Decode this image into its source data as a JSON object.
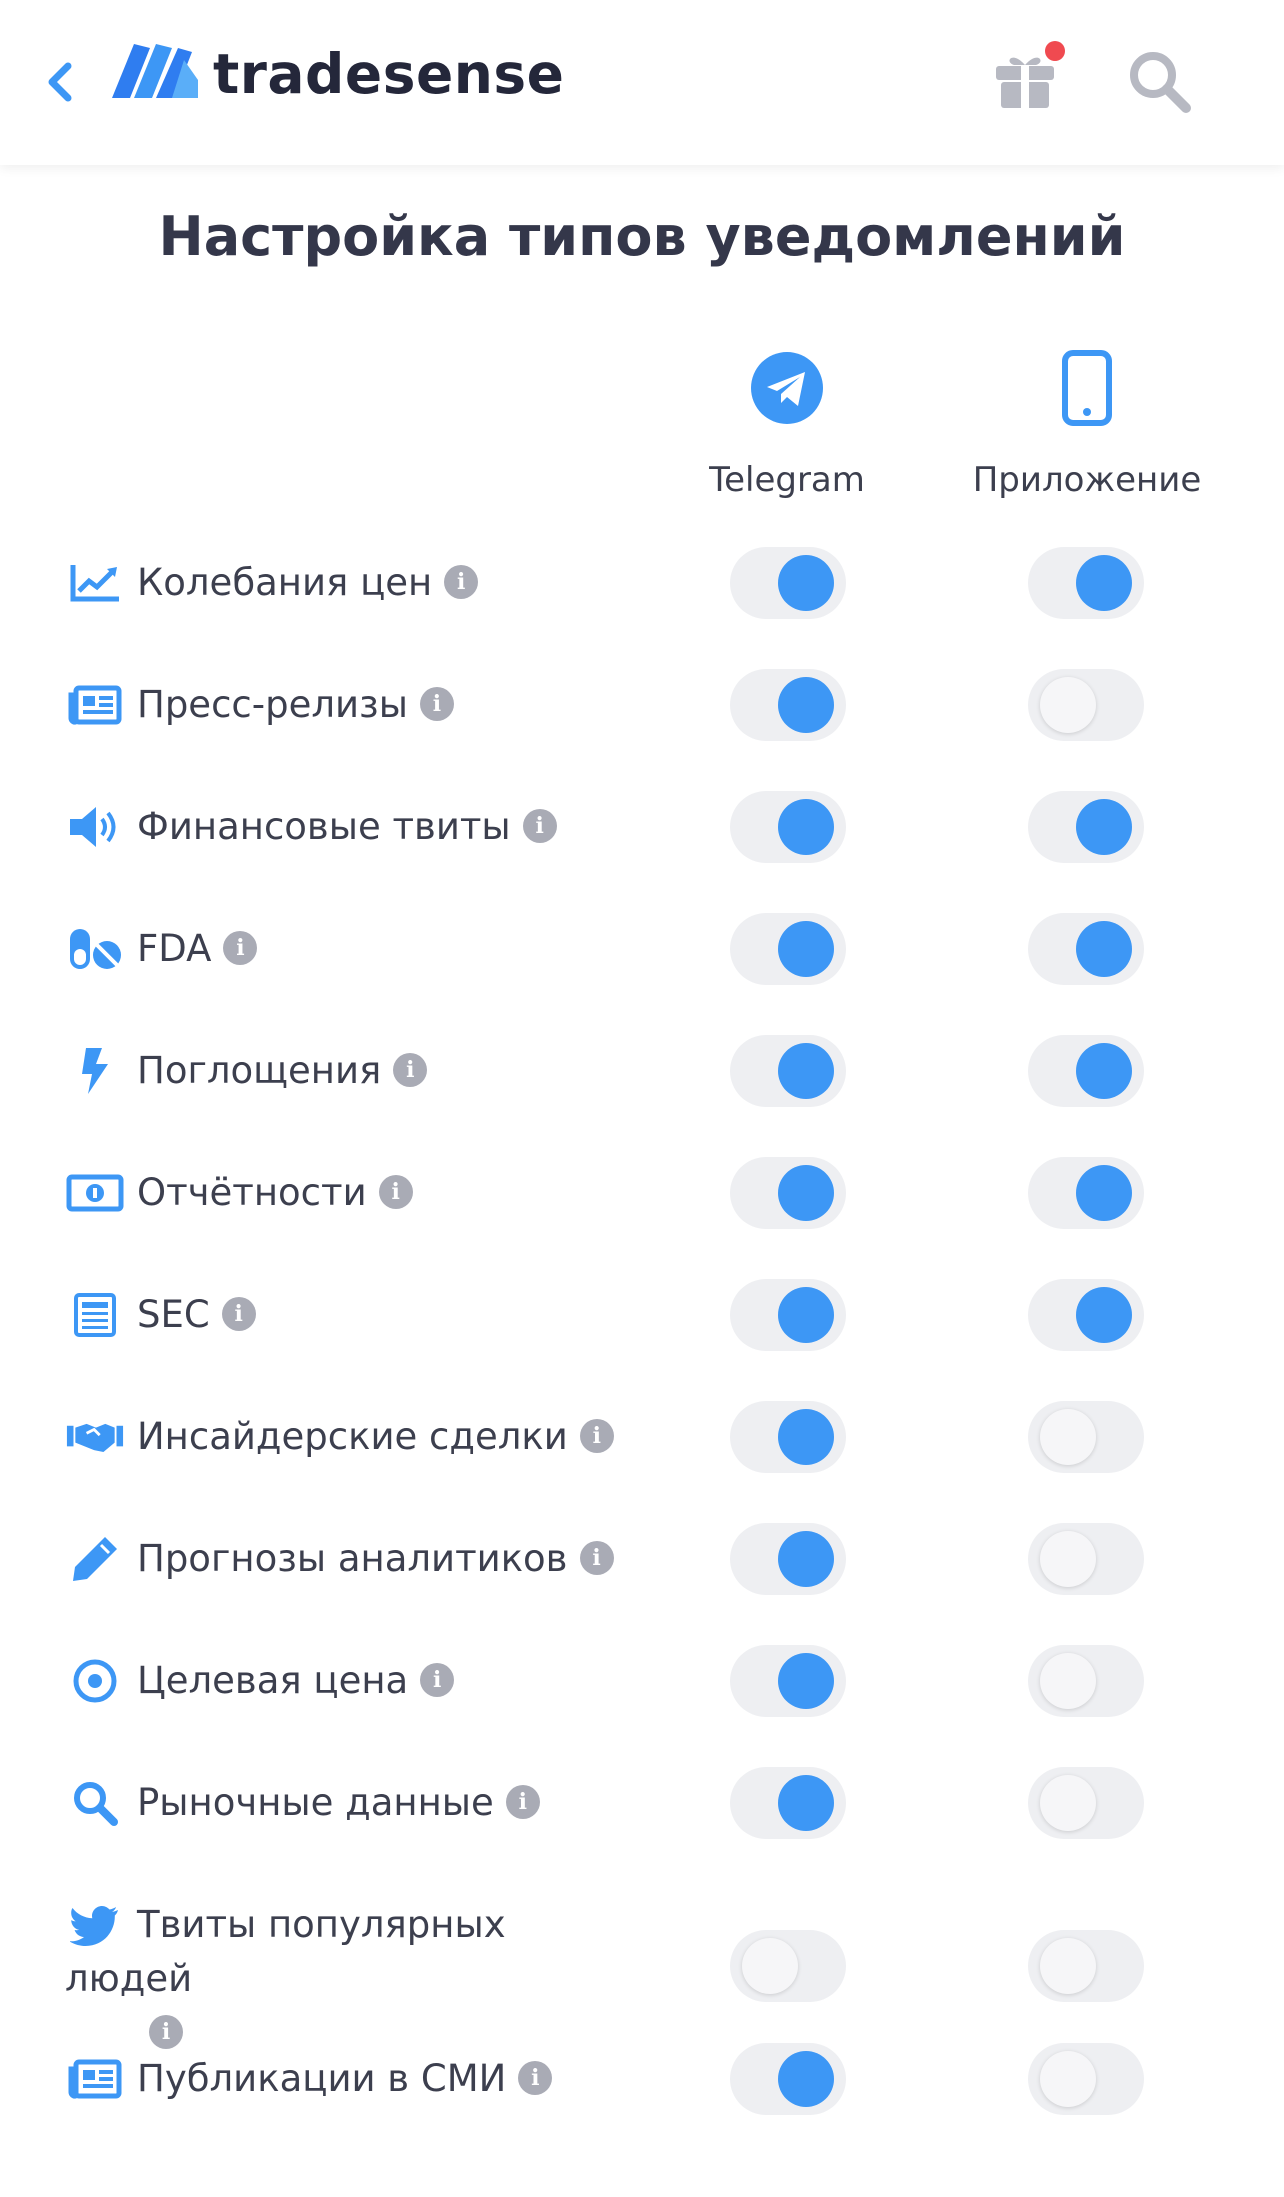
{
  "header": {
    "logo_text": "tradesense",
    "gift_badge_color": "#f04a50"
  },
  "page_title": "Настройка типов уведомлений",
  "columns": {
    "telegram": "Telegram",
    "app": "Приложение"
  },
  "accent_color": "#3d97f5",
  "rows": [
    {
      "label": "Колебания цен",
      "icon": "chart-line-icon",
      "telegram": true,
      "app": true
    },
    {
      "label": "Пресс-релизы",
      "icon": "newspaper-icon",
      "telegram": true,
      "app": false
    },
    {
      "label": "Финансовые твиты",
      "icon": "megaphone-icon",
      "telegram": true,
      "app": true
    },
    {
      "label": "FDA",
      "icon": "pills-icon",
      "telegram": true,
      "app": true
    },
    {
      "label": "Поглощения",
      "icon": "lightning-icon",
      "telegram": true,
      "app": true
    },
    {
      "label": "Отчётности",
      "icon": "money-bill-icon",
      "telegram": true,
      "app": true
    },
    {
      "label": "SEC",
      "icon": "document-list-icon",
      "telegram": true,
      "app": true
    },
    {
      "label": "Инсайдерские сделки",
      "icon": "handshake-icon",
      "telegram": true,
      "app": false
    },
    {
      "label": "Прогнозы аналитиков",
      "icon": "pen-icon",
      "telegram": true,
      "app": false
    },
    {
      "label": "Целевая цена",
      "icon": "target-icon",
      "telegram": true,
      "app": false
    },
    {
      "label": "Рыночные данные",
      "icon": "search-icon",
      "telegram": true,
      "app": false
    },
    {
      "label": "Твиты популярных",
      "label_line2": "людей",
      "icon": "twitter-bird-icon",
      "telegram": false,
      "app": false
    },
    {
      "label": "Публикации в СМИ",
      "icon": "newspaper-icon",
      "telegram": true,
      "app": false
    }
  ]
}
